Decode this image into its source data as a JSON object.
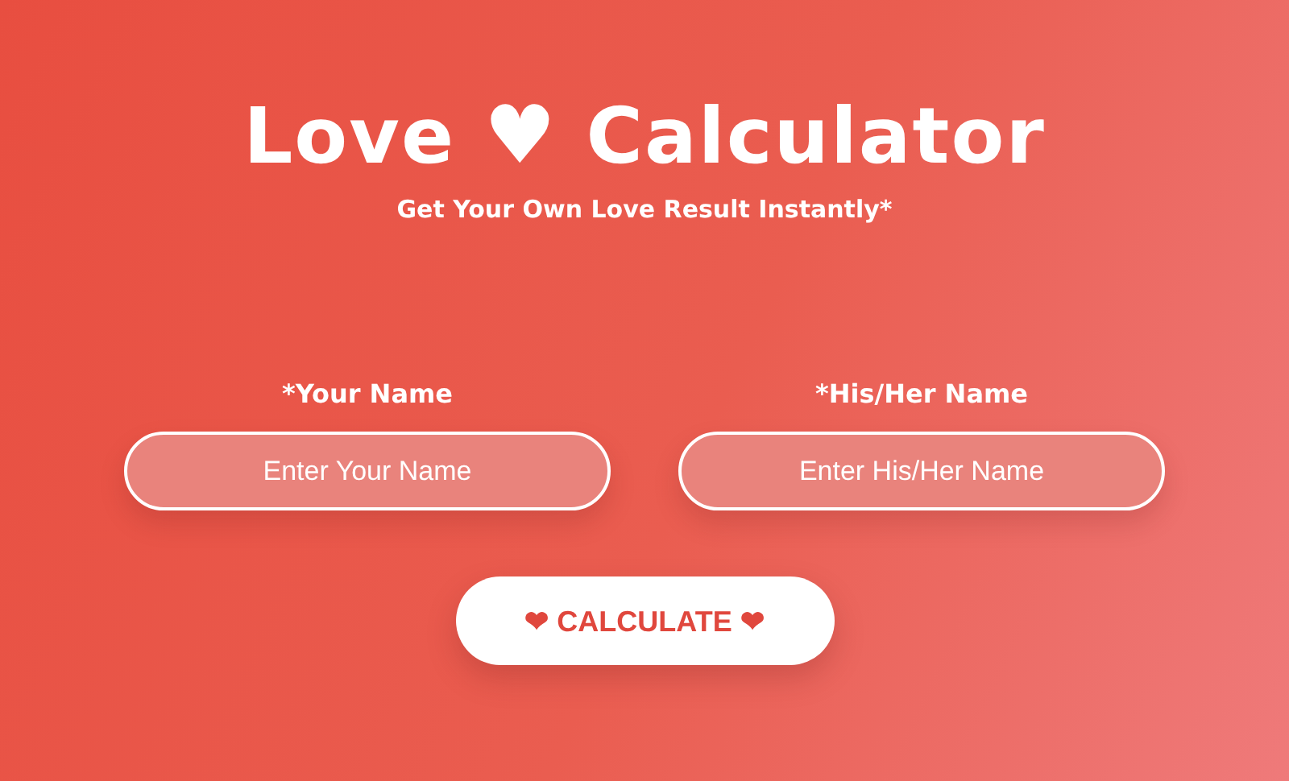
{
  "title": {
    "before": "Love",
    "heart": "♥",
    "after": "Calculator"
  },
  "subtitle": "Get Your Own Love Result Instantly*",
  "fields": [
    {
      "label": "*Your Name",
      "placeholder": "Enter Your Name"
    },
    {
      "label": "*His/Her Name",
      "placeholder": "Enter His/Her Name"
    }
  ],
  "button": {
    "icon_left": "❤",
    "label": "CALCULATE",
    "icon_right": "❤"
  }
}
